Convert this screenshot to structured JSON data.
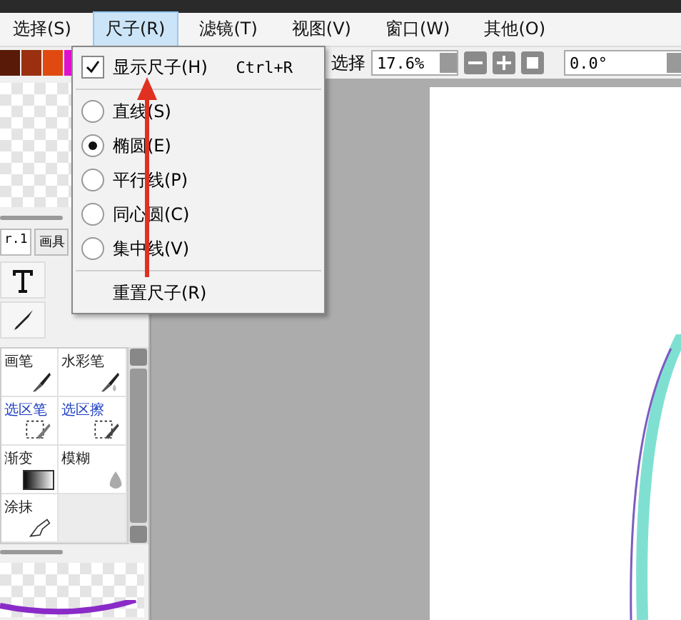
{
  "menu_bar": [
    {
      "label": "选择(S)",
      "selected": false
    },
    {
      "label": "尺子(R)",
      "selected": true
    },
    {
      "label": "滤镜(T)",
      "selected": false
    },
    {
      "label": "视图(V)",
      "selected": false
    },
    {
      "label": "窗口(W)",
      "selected": false
    },
    {
      "label": "其他(O)",
      "selected": false
    }
  ],
  "ruler_menu": [
    {
      "kind": "check",
      "label": "显示尺子(H)",
      "shortcut": "Ctrl+R",
      "checked": true
    },
    {
      "kind": "radio",
      "label": "直线(S)",
      "selected": false
    },
    {
      "kind": "radio",
      "label": "椭圆(E)",
      "selected": true
    },
    {
      "kind": "radio",
      "label": "平行线(P)",
      "selected": false
    },
    {
      "kind": "radio",
      "label": "同心圆(C)",
      "selected": false
    },
    {
      "kind": "radio",
      "label": "集中线(V)",
      "selected": false
    },
    {
      "kind": "command",
      "label": "重置尺子(R)"
    }
  ],
  "toolbar": {
    "mode_label": "选择",
    "zoom": "17.6%",
    "angle": "0.0°"
  },
  "left_panel": {
    "swatches": [
      {
        "color": "#5a1a08"
      },
      {
        "color": "#9a3010"
      },
      {
        "color": "#e04a10"
      },
      {
        "color": "#e010d0"
      }
    ],
    "tabs": [
      {
        "label": "r.1",
        "selected": true
      },
      {
        "label": "画具",
        "selected": false
      }
    ],
    "tools": [
      {
        "kind": "brush",
        "label": "画笔"
      },
      {
        "kind": "watercolor",
        "label": "水彩笔"
      },
      {
        "kind": "select-pen",
        "label": "选区笔"
      },
      {
        "kind": "select-eraser",
        "label": "选区擦"
      },
      {
        "kind": "gradient",
        "label": "渐变"
      },
      {
        "kind": "blur",
        "label": "模糊"
      },
      {
        "kind": "smudge",
        "label": "涂抹"
      }
    ]
  }
}
